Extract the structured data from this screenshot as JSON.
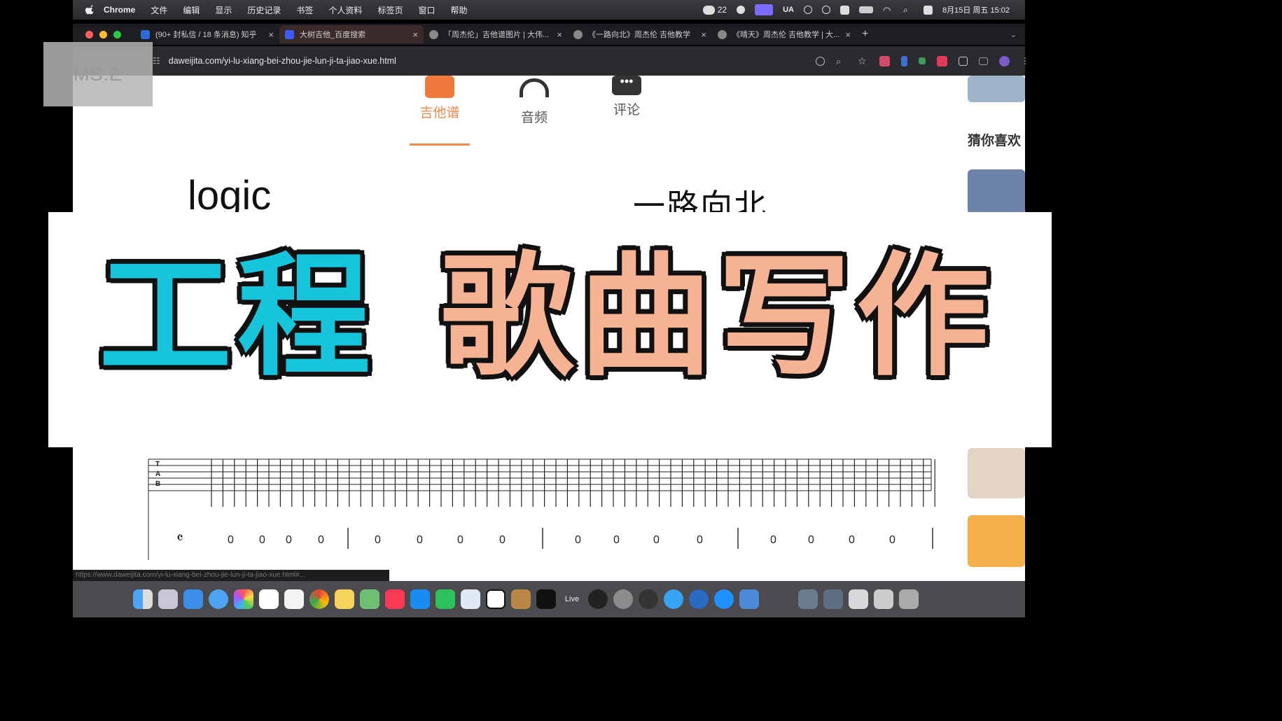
{
  "menubar": {
    "items": [
      "Chrome",
      "文件",
      "编辑",
      "显示",
      "历史记录",
      "书签",
      "个人资料",
      "标签页",
      "窗口",
      "帮助"
    ],
    "wechat_count": "22",
    "ua_label": "UA",
    "datetime": "8月15日 周五 15:02"
  },
  "browser": {
    "tabs": [
      {
        "title": "(90+ 封私信 / 18 条消息) 知乎",
        "color": "#2f6bd8"
      },
      {
        "title": "大树吉他_百度搜索",
        "color": "#3a5cff"
      },
      {
        "title": "「周杰伦」吉他谱图片 | 大伟...",
        "color": "#888888"
      },
      {
        "title": "《一路向北》周杰伦 吉他教学",
        "color": "#888888"
      },
      {
        "title": "《晴天》周杰伦 吉他教学 | 大...",
        "color": "#888888"
      }
    ],
    "new_tab": "+",
    "url": "daweijita.com/yi-lu-xiang-bei-zhou-jie-lun-ji-ta-jiao-xue.html",
    "status_url": "https://www.daweijita.com/yi-lu-xiang-bei-zhou-jie-lun-ji-ta-jiao-xue.html#..."
  },
  "watermark": "MS.E",
  "page": {
    "content_tabs": [
      "吉他谱",
      "音频",
      "评论"
    ],
    "active_tab": 0,
    "sidebar_title": "猜你喜欢",
    "logic_label": "logic",
    "song_title": "一路向北"
  },
  "banner": {
    "left": "工程",
    "right": "歌曲写作"
  },
  "tab_sheet": {
    "time_signature": "4/4",
    "bass_row": [
      "0",
      "0",
      "0",
      "0",
      "0",
      "0",
      "0",
      "0",
      "0",
      "0",
      "0",
      "0",
      "0",
      "0",
      "0",
      "0"
    ]
  },
  "dock": {
    "live_label": "Live"
  },
  "colors": {
    "accent_orange": "#f08a4b",
    "banner_cyan": "#16c5dc",
    "banner_peach": "#f5b393"
  }
}
